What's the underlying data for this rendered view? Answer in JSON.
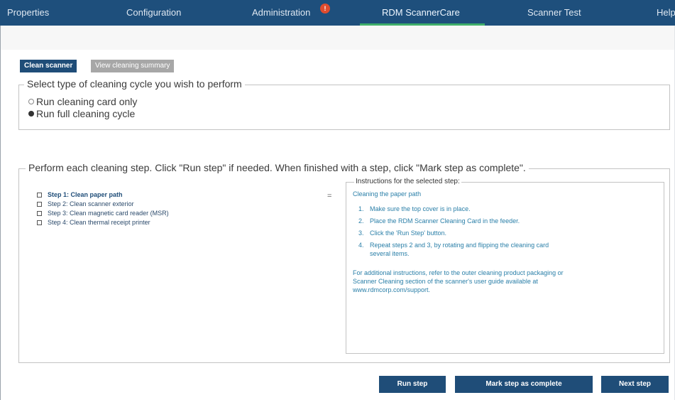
{
  "nav": {
    "tabs": [
      "Properties",
      "Configuration",
      "Administration",
      "RDM ScannerCare",
      "Scanner Test",
      "Help"
    ],
    "active_tab": "RDM ScannerCare",
    "admin_badge": "!"
  },
  "content_tabs": {
    "clean": "Clean scanner",
    "summary": "View cleaning summary"
  },
  "cycle": {
    "title": "Select type of cleaning cycle you wish to perform",
    "options": [
      "Run cleaning card only",
      "Run full cleaning cycle"
    ],
    "selected": "Run full cleaning cycle"
  },
  "steps": {
    "title": "Perform each cleaning step. Click \"Run step\" if needed. When finished with a step, click \"Mark step as complete\".",
    "items": [
      "Step 1: Clean paper path",
      "Step 2: Clean scanner exterior",
      "Step 3: Clean magnetic card reader (MSR)",
      "Step 4: Clean thermal receipt printer"
    ],
    "current_indicator": "="
  },
  "instructions": {
    "title": "Instructions for the selected step:",
    "heading": "Cleaning the paper path",
    "list": [
      {
        "num": "1.",
        "lines": [
          "Make sure the top cover is in place."
        ]
      },
      {
        "num": "2.",
        "lines": [
          "Place the RDM Scanner Cleaning Card in the feeder."
        ]
      },
      {
        "num": "3.",
        "lines": [
          "Click the 'Run Step' button."
        ]
      },
      {
        "num": "4.",
        "lines": [
          "Repeat steps 2 and 3, by rotating and flipping the cleaning card",
          "several items."
        ]
      }
    ],
    "note_lines": [
      "For additional instructions, refer to the outer cleaning product packaging or",
      "Scanner Cleaning section of the scanner's user guide available at",
      "www.rdmcorp.com/support."
    ]
  },
  "buttons": {
    "run": "Run step",
    "mark": "Mark step as complete",
    "next": "Next step"
  },
  "colors": {
    "nav_bg": "#1e4f7c",
    "active_underline": "#3fae6a",
    "primary_button": "#1f4d78",
    "instruction_text": "#2a7fa8",
    "badge": "#e04c2e"
  }
}
